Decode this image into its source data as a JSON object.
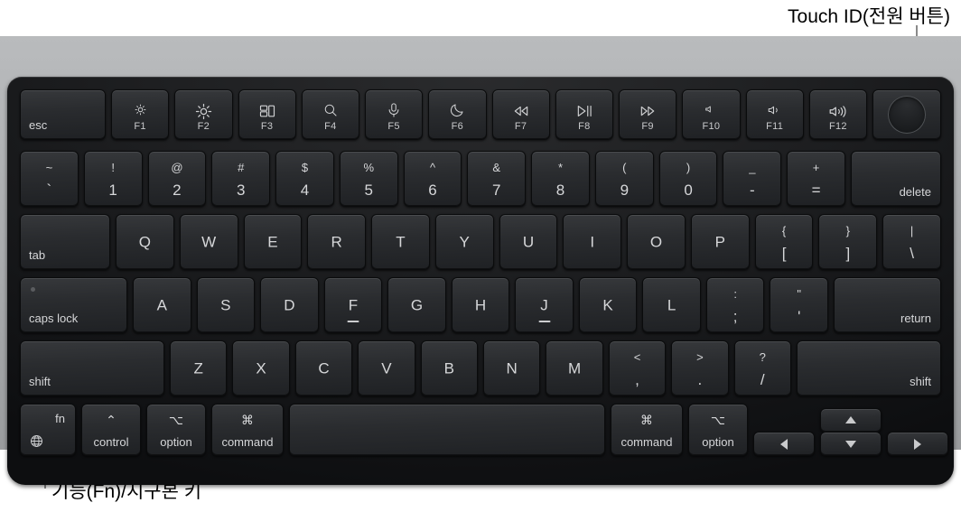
{
  "annotations": {
    "touch_id": "Touch ID(전원 버튼)",
    "fn_globe": "기능(Fn)/지구본 키"
  },
  "colors": {
    "chassis": "#aaacae",
    "keyboard_body": "#0c0d0f",
    "key_face": "#2b2d30",
    "key_label": "#d6d7d9",
    "annotation_text": "#000000",
    "leader_line": "#8a8a8a"
  },
  "keyboard": {
    "function_row": [
      {
        "name": "esc",
        "label": "esc",
        "icon": null,
        "fkey": null
      },
      {
        "name": "f1",
        "label": null,
        "icon": "brightness-down-icon",
        "fkey": "F1"
      },
      {
        "name": "f2",
        "label": null,
        "icon": "brightness-up-icon",
        "fkey": "F2"
      },
      {
        "name": "f3",
        "label": null,
        "icon": "mission-control-icon",
        "fkey": "F3"
      },
      {
        "name": "f4",
        "label": null,
        "icon": "spotlight-search-icon",
        "fkey": "F4"
      },
      {
        "name": "f5",
        "label": null,
        "icon": "dictation-microphone-icon",
        "fkey": "F5"
      },
      {
        "name": "f6",
        "label": null,
        "icon": "do-not-disturb-moon-icon",
        "fkey": "F6"
      },
      {
        "name": "f7",
        "label": null,
        "icon": "rewind-icon",
        "fkey": "F7"
      },
      {
        "name": "f8",
        "label": null,
        "icon": "play-pause-icon",
        "fkey": "F8"
      },
      {
        "name": "f9",
        "label": null,
        "icon": "fast-forward-icon",
        "fkey": "F9"
      },
      {
        "name": "f10",
        "label": null,
        "icon": "mute-icon",
        "fkey": "F10"
      },
      {
        "name": "f11",
        "label": null,
        "icon": "volume-down-icon",
        "fkey": "F11"
      },
      {
        "name": "f12",
        "label": null,
        "icon": "volume-up-icon",
        "fkey": "F12"
      },
      {
        "name": "touch-id",
        "label": null,
        "icon": "touch-id-circle",
        "fkey": null
      }
    ],
    "number_row": [
      {
        "name": "grave",
        "top": "~",
        "bottom": "`"
      },
      {
        "name": "one",
        "top": "!",
        "bottom": "1"
      },
      {
        "name": "two",
        "top": "@",
        "bottom": "2"
      },
      {
        "name": "three",
        "top": "#",
        "bottom": "3"
      },
      {
        "name": "four",
        "top": "$",
        "bottom": "4"
      },
      {
        "name": "five",
        "top": "%",
        "bottom": "5"
      },
      {
        "name": "six",
        "top": "^",
        "bottom": "6"
      },
      {
        "name": "seven",
        "top": "&",
        "bottom": "7"
      },
      {
        "name": "eight",
        "top": "*",
        "bottom": "8"
      },
      {
        "name": "nine",
        "top": "(",
        "bottom": "9"
      },
      {
        "name": "zero",
        "top": ")",
        "bottom": "0"
      },
      {
        "name": "minus",
        "top": "_",
        "bottom": "-"
      },
      {
        "name": "equal",
        "top": "+",
        "bottom": "="
      },
      {
        "name": "delete",
        "top": null,
        "bottom": null,
        "label": "delete"
      }
    ],
    "top_row": [
      {
        "name": "tab",
        "label": "tab"
      },
      {
        "name": "q",
        "label": "Q"
      },
      {
        "name": "w",
        "label": "W"
      },
      {
        "name": "e",
        "label": "E"
      },
      {
        "name": "r",
        "label": "R"
      },
      {
        "name": "t",
        "label": "T"
      },
      {
        "name": "y",
        "label": "Y"
      },
      {
        "name": "u",
        "label": "U"
      },
      {
        "name": "i",
        "label": "I"
      },
      {
        "name": "o",
        "label": "O"
      },
      {
        "name": "p",
        "label": "P"
      },
      {
        "name": "bracket-left",
        "top": "{",
        "bottom": "["
      },
      {
        "name": "bracket-right",
        "top": "}",
        "bottom": "]"
      },
      {
        "name": "backslash",
        "top": "|",
        "bottom": "\\"
      }
    ],
    "home_row": [
      {
        "name": "caps-lock",
        "label": "caps lock"
      },
      {
        "name": "a",
        "label": "A"
      },
      {
        "name": "s",
        "label": "S"
      },
      {
        "name": "d",
        "label": "D"
      },
      {
        "name": "f",
        "label": "F",
        "homing": true
      },
      {
        "name": "g",
        "label": "G"
      },
      {
        "name": "h",
        "label": "H"
      },
      {
        "name": "j",
        "label": "J",
        "homing": true
      },
      {
        "name": "k",
        "label": "K"
      },
      {
        "name": "l",
        "label": "L"
      },
      {
        "name": "semicolon",
        "top": ":",
        "bottom": ";"
      },
      {
        "name": "quote",
        "top": "\"",
        "bottom": "'"
      },
      {
        "name": "return",
        "label": "return"
      }
    ],
    "bottom_row": [
      {
        "name": "shift-left",
        "label": "shift"
      },
      {
        "name": "z",
        "label": "Z"
      },
      {
        "name": "x",
        "label": "X"
      },
      {
        "name": "c",
        "label": "C"
      },
      {
        "name": "v",
        "label": "V"
      },
      {
        "name": "b",
        "label": "B"
      },
      {
        "name": "n",
        "label": "N"
      },
      {
        "name": "m",
        "label": "M"
      },
      {
        "name": "comma",
        "top": "<",
        "bottom": ","
      },
      {
        "name": "period",
        "top": ">",
        "bottom": "."
      },
      {
        "name": "slash",
        "top": "?",
        "bottom": "/"
      },
      {
        "name": "shift-right",
        "label": "shift"
      }
    ],
    "modifier_row": [
      {
        "name": "fn",
        "label": "fn",
        "icon": "globe-icon"
      },
      {
        "name": "control-left",
        "glyph": "⌃",
        "label": "control"
      },
      {
        "name": "option-left",
        "glyph": "⌥",
        "label": "option"
      },
      {
        "name": "command-left",
        "glyph": "⌘",
        "label": "command"
      },
      {
        "name": "space",
        "glyph": null,
        "label": null
      },
      {
        "name": "command-right",
        "glyph": "⌘",
        "label": "command"
      },
      {
        "name": "option-right",
        "glyph": "⌥",
        "label": "option"
      },
      {
        "name": "arrow-left",
        "glyph": "◀",
        "label": null
      },
      {
        "name": "arrow-up",
        "glyph": "▲",
        "label": null
      },
      {
        "name": "arrow-down",
        "glyph": "▼",
        "label": null
      },
      {
        "name": "arrow-right",
        "glyph": "▶",
        "label": null
      }
    ]
  }
}
